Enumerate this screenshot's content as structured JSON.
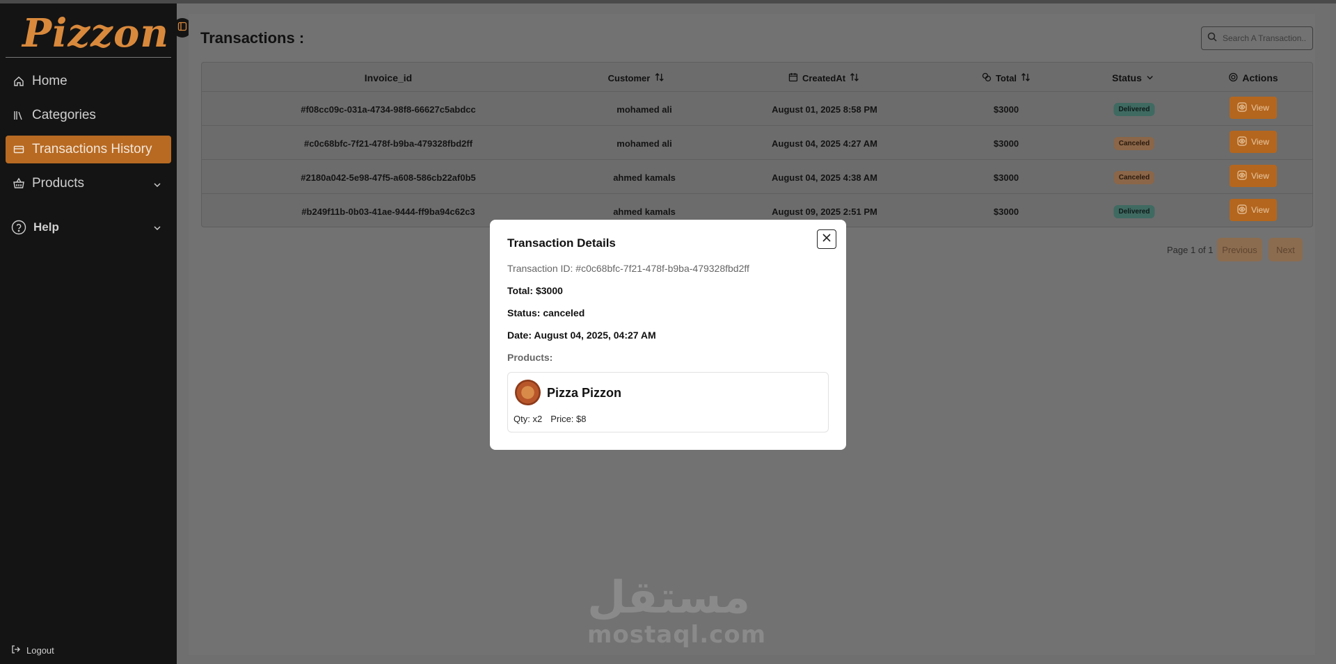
{
  "brand": {
    "logo_text": "Pizzon"
  },
  "sidebar": {
    "items": [
      {
        "label": "Home",
        "icon": "home-icon"
      },
      {
        "label": "Categories",
        "icon": "library-icon"
      },
      {
        "label": "Transactions History",
        "icon": "card-icon",
        "active": true
      },
      {
        "label": "Products",
        "icon": "basket-icon",
        "has_submenu": true
      },
      {
        "label": "Help",
        "icon": "help-circle-icon",
        "has_submenu": true
      }
    ],
    "logout_label": "Logout"
  },
  "page": {
    "title": "Transactions :",
    "search_placeholder": "Search A Transaction..."
  },
  "table": {
    "columns": {
      "invoice": "Invoice_id",
      "customer": "Customer",
      "created": "CreatedAt",
      "total": "Total",
      "status": "Status",
      "actions": "Actions"
    },
    "view_label": "View",
    "rows": [
      {
        "invoice": "#f08cc09c-031a-4734-98f8-66627c5abdcc",
        "customer": "mohamed ali",
        "created": "August 01, 2025 8:58 PM",
        "total": "$3000",
        "status": "Delivered"
      },
      {
        "invoice": "#c0c68bfc-7f21-478f-b9ba-479328fbd2ff",
        "customer": "mohamed ali",
        "created": "August 04, 2025 4:27 AM",
        "total": "$3000",
        "status": "Canceled"
      },
      {
        "invoice": "#2180a042-5e98-47f5-a608-586cb22af0b5",
        "customer": "ahmed kamals",
        "created": "August 04, 2025 4:38 AM",
        "total": "$3000",
        "status": "Canceled"
      },
      {
        "invoice": "#b249f11b-0b03-41ae-9444-ff9ba94c62c3",
        "customer": "ahmed kamals",
        "created": "August 09, 2025 2:51 PM",
        "total": "$3000",
        "status": "Delivered"
      }
    ]
  },
  "pagination": {
    "text": "Page 1 of 1",
    "previous_label": "Previous",
    "next_label": "Next"
  },
  "modal": {
    "title": "Transaction Details",
    "transaction_id": "Transaction ID: #c0c68bfc-7f21-478f-b9ba-479328fbd2ff",
    "total": "Total: $3000",
    "status": "Status: canceled",
    "date": "Date: August 04, 2025, 04:27 AM",
    "products_label": "Products:",
    "products": [
      {
        "name": "Pizza Pizzon",
        "qty": "Qty: x2",
        "price": "Price: $8"
      }
    ]
  },
  "watermark": {
    "arabic": "مستقل",
    "latin": "mostaql.com"
  },
  "colors": {
    "accent": "#b4661e",
    "sidebar": "#141414",
    "delivered": "#3f6a62",
    "canceled": "#8b6648"
  }
}
